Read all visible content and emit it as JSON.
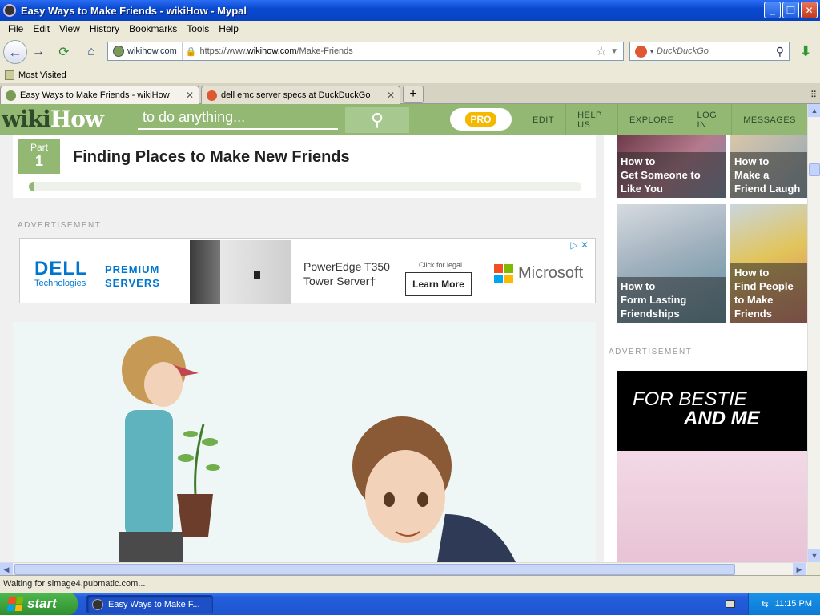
{
  "window": {
    "title": "Easy Ways to Make Friends - wikiHow - Mypal",
    "controls": {
      "minimize": "_",
      "maximize": "❐",
      "close": "✕"
    }
  },
  "menu": [
    "File",
    "Edit",
    "View",
    "History",
    "Bookmarks",
    "Tools",
    "Help"
  ],
  "nav": {
    "site_identity": "wikihow.com",
    "url_prefix": "https://www.",
    "url_domain": "wikihow.com",
    "url_path": "/Make-Friends",
    "search_placeholder": "DuckDuckGo"
  },
  "bookmarks": {
    "most_visited": "Most Visited"
  },
  "tabs": [
    {
      "label": "Easy Ways to Make Friends - wikiHow",
      "active": true,
      "favicon_color": "#7a9a55"
    },
    {
      "label": "dell emc server specs at DuckDuckGo",
      "active": false,
      "favicon_color": "#de5833"
    }
  ],
  "wikihow": {
    "logo_wiki": "wiki",
    "logo_how": "How",
    "search_placeholder": "to do anything...",
    "pro": "PRO",
    "nav": [
      "EDIT",
      "HELP US",
      "EXPLORE",
      "LOG IN",
      "MESSAGES"
    ],
    "accent": "#93b874"
  },
  "article": {
    "part_label": "Part",
    "part_number": "1",
    "part_title": "Finding Places to Make New Friends",
    "progress": 0.01
  },
  "ad": {
    "label": "ADVERTISEMENT",
    "brand": "DELL",
    "brand_sub": "Technologies",
    "tagline_1": "PREMIUM",
    "tagline_2": "SERVERS",
    "product_1": "PowerEdge T350",
    "product_2": "Tower Server†",
    "legal": "Click for legal",
    "cta": "Learn More",
    "partner": "Microsoft"
  },
  "sidebar": {
    "related": [
      {
        "prefix": "How to",
        "title": "Get Someone to Like You"
      },
      {
        "prefix": "How to",
        "title": "Make a Friend Laugh"
      },
      {
        "prefix": "How to",
        "title": "Form Lasting Friendships"
      },
      {
        "prefix": "How to",
        "title": "Find People to Make Friends"
      }
    ],
    "ad_label": "ADVERTISEMENT",
    "ad_line1": "FOR BESTIE",
    "ad_line2": "AND ME"
  },
  "status": "Waiting for simage4.pubmatic.com...",
  "taskbar": {
    "start": "start",
    "task": "Easy Ways to Make F...",
    "clock": "11:15 PM"
  }
}
